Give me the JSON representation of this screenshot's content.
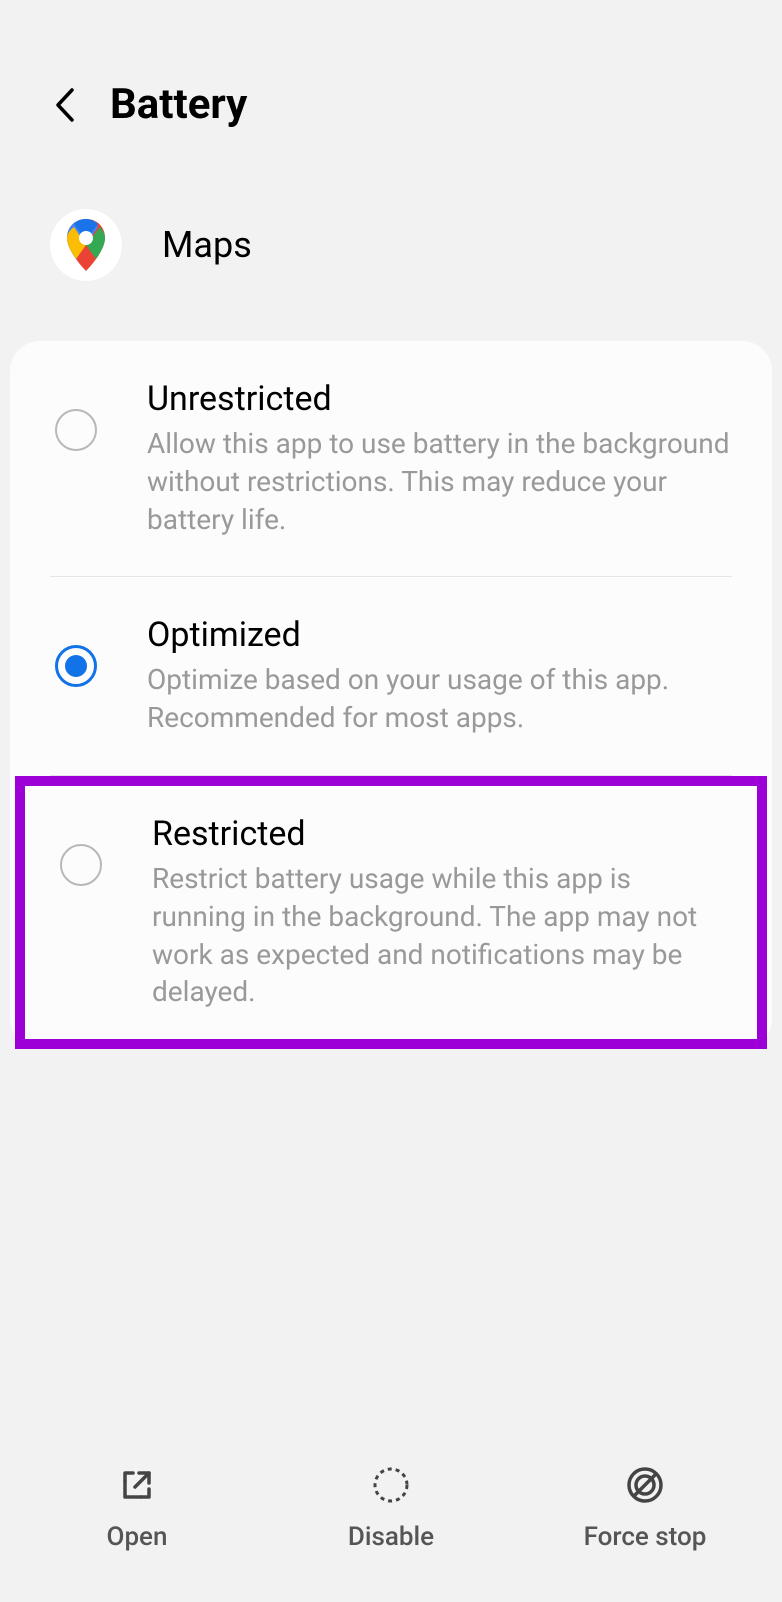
{
  "header": {
    "title": "Battery"
  },
  "app": {
    "name": "Maps"
  },
  "options": [
    {
      "title": "Unrestricted",
      "desc": "Allow this app to use battery in the background without restrictions. This may reduce your battery life.",
      "selected": false,
      "highlighted": false
    },
    {
      "title": "Optimized",
      "desc": "Optimize based on your usage of this app. Recommended for most apps.",
      "selected": true,
      "highlighted": false
    },
    {
      "title": "Restricted",
      "desc": "Restrict battery usage while this app is running in the background. The app may not work as expected and notifications may be delayed.",
      "selected": false,
      "highlighted": true
    }
  ],
  "bottom": {
    "open": "Open",
    "disable": "Disable",
    "force_stop": "Force stop"
  }
}
